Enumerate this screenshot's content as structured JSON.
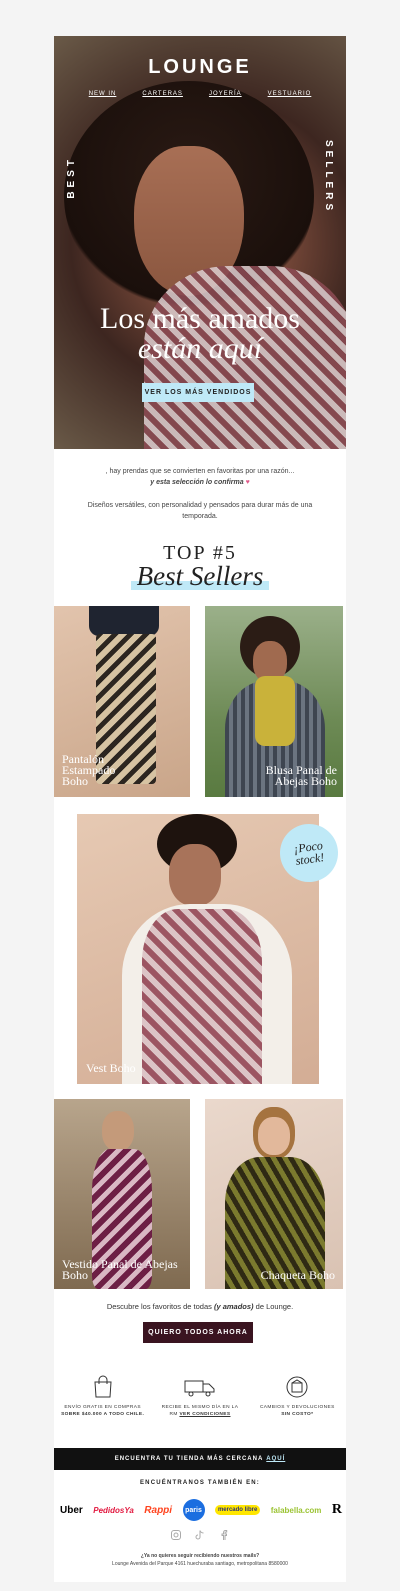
{
  "hero": {
    "logo": "LOUNGE",
    "nav": [
      "NEW IN",
      "CARTERAS",
      "JOYERÍA",
      "VESTUARIO"
    ],
    "side_left": "BEST",
    "side_right": "SELLERS",
    "headline_line1": "Los más amados",
    "headline_line2": "están aquí",
    "cta": "VER LOS MÁS VENDIDOS"
  },
  "intro": {
    "line1": ", hay prendas que se convierten en favoritas por una razón...",
    "line2": "y esta selección lo confirma",
    "heart": "♥",
    "para2": "Diseños versátiles, con personalidad y pensados para durar más de una temporada."
  },
  "top": {
    "number": "TOP #5",
    "title": "Best Sellers"
  },
  "products": [
    {
      "name": "Pantalón Estampado Boho"
    },
    {
      "name": "Blusa Panal de Abejas Boho"
    },
    {
      "name": "Vest Boho"
    },
    {
      "name": "Vestido Panal de Abejas Boho"
    },
    {
      "name": "Chaqueta Boho"
    }
  ],
  "stamp": {
    "line1": "¡Poco",
    "line2": "stock!"
  },
  "outro": {
    "before": "Descubre los favoritos de todas ",
    "emph": "(y amados)",
    "after": " de Lounge.",
    "cta": "QUIERO TODOS AHORA"
  },
  "benefits": [
    {
      "line1": "ENVÍO GRATIS EN COMPRAS",
      "line2": "SOBRE $40.000 A TODO CHILE.",
      "icon": "shopping-bag-icon"
    },
    {
      "line1": "RECIBE EL MISMO DÍA EN LA",
      "line2a": "RM ",
      "link": "VER CONDICIONES",
      "icon": "truck-icon"
    },
    {
      "line1": "CAMBIOS Y DEVOLUCIONES",
      "line2": "SIN COSTO*",
      "icon": "return-box-icon"
    }
  ],
  "store_bar": {
    "text": "ENCUENTRA TU TIENDA MÁS CERCANA",
    "link": "AQUÍ"
  },
  "find_us": "ENCUÉNTRANOS TAMBIÉN EN:",
  "brands": [
    "Uber",
    "PedidosYa",
    "Rappi",
    "paris",
    "mercado libre",
    "falabella.com",
    "R"
  ],
  "footer": {
    "question": "¿Ya no quieres seguir recibiendo nuestros mails?",
    "address": "Lounge Avenida del Parque 4161 huechuraba santiago, metropolitana 8580000"
  },
  "colors": {
    "accent_light": "#bfe9f7",
    "dark_button": "#3a1420",
    "bar": "#111111"
  }
}
